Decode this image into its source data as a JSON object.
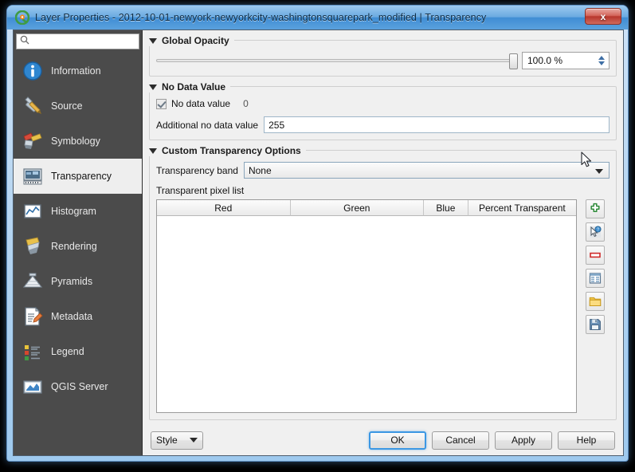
{
  "window": {
    "title": "Layer Properties - 2012-10-01-newyork-newyorkcity-washingtonsquarepark_modified | Transparency",
    "app_icon": "qgis-logo-icon",
    "close_label": "x"
  },
  "sidebar": {
    "search": {
      "value": "",
      "placeholder": "",
      "icon": "search-icon"
    },
    "items": [
      {
        "label": "Information",
        "icon": "info-icon",
        "active": false
      },
      {
        "label": "Source",
        "icon": "wrench-pencil-icon",
        "active": false
      },
      {
        "label": "Symbology",
        "icon": "paintbrush-icon",
        "active": false
      },
      {
        "label": "Transparency",
        "icon": "transparency-raster-icon",
        "active": true
      },
      {
        "label": "Histogram",
        "icon": "histogram-icon",
        "active": false
      },
      {
        "label": "Rendering",
        "icon": "brush-icon",
        "active": false
      },
      {
        "label": "Pyramids",
        "icon": "pyramid-icon",
        "active": false
      },
      {
        "label": "Metadata",
        "icon": "document-pencil-icon",
        "active": false
      },
      {
        "label": "Legend",
        "icon": "legend-list-icon",
        "active": false
      },
      {
        "label": "QGIS Server",
        "icon": "qgis-server-icon",
        "active": false
      }
    ]
  },
  "global_opacity": {
    "title": "Global Opacity",
    "slider_value": 100,
    "slider_min": 0,
    "slider_max": 100,
    "spin_value": "100.0 %"
  },
  "no_data_value": {
    "title": "No Data Value",
    "checkbox_label": "No data value",
    "checkbox_checked": true,
    "current_value": "0",
    "additional_label": "Additional no data value",
    "additional_value": "255"
  },
  "custom_transparency": {
    "title": "Custom Transparency Options",
    "band_label": "Transparency band",
    "band_value": "None",
    "pixel_list_label": "Transparent pixel list",
    "table": {
      "columns": [
        "Red",
        "Green",
        "Blue",
        "Percent Transparent"
      ],
      "rows": []
    },
    "tools": [
      {
        "name": "add-values-manually-button",
        "icon": "green-plus-icon"
      },
      {
        "name": "add-values-from-display-button",
        "icon": "pick-cursor-icon"
      },
      {
        "name": "remove-selected-row-button",
        "icon": "red-minus-icon"
      },
      {
        "name": "default-values-button",
        "icon": "table-icon"
      },
      {
        "name": "import-from-file-button",
        "icon": "open-folder-icon"
      },
      {
        "name": "export-to-file-button",
        "icon": "save-floppy-icon"
      }
    ]
  },
  "footer": {
    "style_label": "Style",
    "ok_label": "OK",
    "cancel_label": "Cancel",
    "apply_label": "Apply",
    "help_label": "Help"
  },
  "colors": {
    "titlebar_accent": "#3f8dd4",
    "sidebar_bg": "#4b4b4b",
    "sidebar_active_bg": "#eeeeee",
    "dialog_bg": "#f0f0f0",
    "default_button_border": "#3b97e3",
    "close_button": "#b8372c"
  }
}
